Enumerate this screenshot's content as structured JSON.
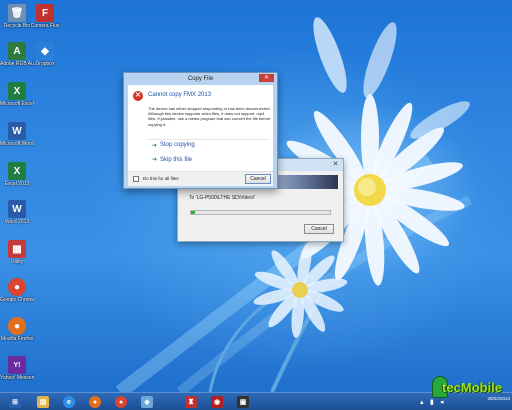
{
  "desktop": {
    "icons": [
      {
        "label": "Recycle Bin",
        "glyph": "🗑",
        "color": "#6f8fb3"
      },
      {
        "label": "Camera Flux",
        "glyph": "F",
        "color": "#c0302c"
      },
      {
        "label": "Adobe RGB Audit",
        "glyph": "A",
        "color": "#2f7a3f"
      },
      {
        "label": "Dropbox",
        "glyph": "◆",
        "color": "#2a7fd8"
      },
      {
        "label": "Microsoft Excel 2013",
        "glyph": "X",
        "color": "#1e7d3f"
      },
      {
        "label": "Microsoft Word 2013",
        "glyph": "W",
        "color": "#2a5ba9"
      },
      {
        "label": "Excel 2013",
        "glyph": "X",
        "color": "#1e7d3f"
      },
      {
        "label": "Word 2013",
        "glyph": "W",
        "color": "#2a5ba9"
      },
      {
        "label": "Utility",
        "glyph": "▦",
        "color": "#c43a3a"
      },
      {
        "label": "Google Chrome",
        "glyph": "●",
        "color": "#d9452f"
      },
      {
        "label": "Mozilla Firefox",
        "glyph": "●",
        "color": "#e2701b"
      },
      {
        "label": "Yahoo! Messenger",
        "glyph": "Y!",
        "color": "#6b2aa0"
      }
    ]
  },
  "copy_dialog": {
    "title": "Copy File",
    "close_label": "✕",
    "error_icon": "error-x-icon",
    "heading": "Cannot copy FMX 2013",
    "message": "The device has either stopped responding or has been disconnected. Although this device supports video files, it does not support .mp4 files. If possible, use a media program that can convert the file before copying it.",
    "options": [
      {
        "label": "Stop copying"
      },
      {
        "label": "Skip this file"
      }
    ],
    "checkbox_label": "Do this for all files",
    "cancel_label": "Cancel"
  },
  "progress_window": {
    "close_label": "✕",
    "to_text": "To 'LG-P500\\LTHE SD\\Video\\'",
    "progress_percent": 3,
    "cancel_label": "Cancel"
  },
  "taskbar": {
    "items": [
      {
        "name": "start-icon",
        "glyph": "⊞",
        "color": "#2a5fb0"
      },
      {
        "name": "file-explorer-icon",
        "glyph": "▤",
        "color": "#e0b54a"
      },
      {
        "name": "internet-explorer-icon",
        "glyph": "e",
        "color": "#2f8ee0"
      },
      {
        "name": "firefox-icon",
        "glyph": "●",
        "color": "#e2701b"
      },
      {
        "name": "chrome-icon",
        "glyph": "●",
        "color": "#d9452f"
      },
      {
        "name": "network-icon",
        "glyph": "◈",
        "color": "#6aa8d8"
      },
      {
        "name": "person-icon",
        "glyph": "♜",
        "color": "#c0302c"
      },
      {
        "name": "camera-icon",
        "glyph": "◉",
        "color": "#b02020"
      },
      {
        "name": "media-app-icon",
        "glyph": "▣",
        "color": "#333333"
      }
    ],
    "date": "28/02/2013"
  },
  "watermark": {
    "text": "tecMobile"
  }
}
